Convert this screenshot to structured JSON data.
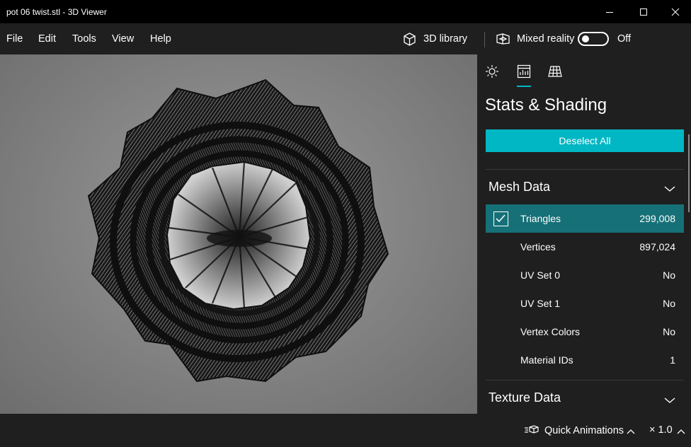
{
  "window": {
    "title": "pot 06 twist.stl - 3D Viewer",
    "controls": [
      "minimize",
      "maximize",
      "close"
    ]
  },
  "menu": {
    "items": [
      "File",
      "Edit",
      "Tools",
      "View",
      "Help"
    ],
    "library_label": "3D library",
    "mixed_reality_label": "Mixed reality",
    "mixed_reality_state": "Off"
  },
  "panel": {
    "tabs": [
      "lighting-icon",
      "stats-icon",
      "grid-icon"
    ],
    "active_tab": "stats-icon",
    "title": "Stats & Shading",
    "deselect_label": "Deselect All",
    "mesh_section": "Mesh Data",
    "rows": [
      {
        "label": "Triangles",
        "value": "299,008",
        "checked": true
      },
      {
        "label": "Vertices",
        "value": "897,024"
      },
      {
        "label": "UV Set 0",
        "value": "No"
      },
      {
        "label": "UV Set 1",
        "value": "No"
      },
      {
        "label": "Vertex Colors",
        "value": "No"
      },
      {
        "label": "Material IDs",
        "value": "1"
      }
    ],
    "texture_section": "Texture Data"
  },
  "bottom": {
    "animations_label": "Quick Animations",
    "speed": "× 1.0"
  },
  "colors": {
    "accent": "#00b7c3",
    "selected_row": "#167077",
    "chrome": "#1f1f1f",
    "titlebar": "#000000"
  }
}
